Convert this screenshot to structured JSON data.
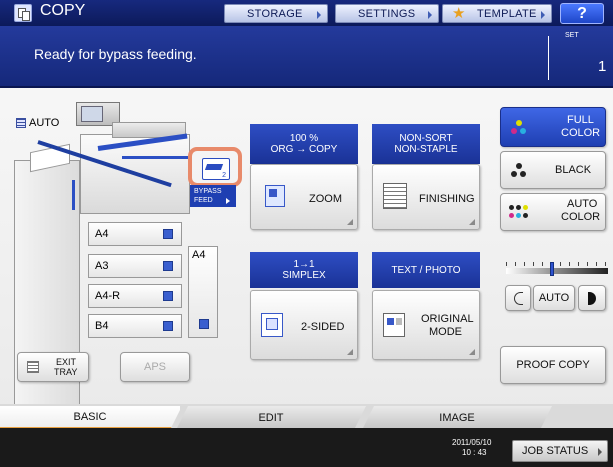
{
  "header": {
    "title": "COPY",
    "buttons": {
      "storage": "STORAGE",
      "settings": "SETTINGS",
      "template": "TEMPLATE",
      "help": "?"
    }
  },
  "message": {
    "text": "Ready for bypass feeding.",
    "set_label": "SET",
    "set_value": "1"
  },
  "machine": {
    "auto_label": "AUTO",
    "bypass_label": "BYPASS\nFEED",
    "bypass_number": "2",
    "trays": [
      "A4",
      "A3",
      "A4-R",
      "B4"
    ],
    "lcf_tray": "A4"
  },
  "functions": {
    "zoom": {
      "header_line1": "100 %",
      "header_line2": "ORG  →  COPY",
      "label": "ZOOM"
    },
    "finishing": {
      "header_line1": "NON-SORT",
      "header_line2": "NON-STAPLE",
      "label": "FINISHING"
    },
    "duplex": {
      "header_line1": "1→1",
      "header_line2": "SIMPLEX",
      "label": "2-SIDED"
    },
    "original": {
      "header_line1": "TEXT / PHOTO",
      "label_line1": "ORIGINAL",
      "label_line2": "MODE"
    }
  },
  "color_modes": {
    "full_line1": "FULL",
    "full_line2": "COLOR",
    "black": "BLACK",
    "auto_line1": "AUTO",
    "auto_line2": "COLOR"
  },
  "density": {
    "auto_label": "AUTO",
    "level": 0.45
  },
  "buttons": {
    "exit_tray_line1": "EXIT",
    "exit_tray_line2": "TRAY",
    "aps": "APS",
    "proof_copy": "PROOF COPY"
  },
  "tabs": [
    "BASIC",
    "EDIT",
    "IMAGE"
  ],
  "footer": {
    "date": "2011/05/10",
    "time": "10 : 43",
    "job_status": "JOB STATUS"
  },
  "colors": {
    "header_bg": "#12247a",
    "message_bg": "#1e34a0",
    "active_tab_underline": "#e8a040",
    "bypass_highlight": "#e88a6a"
  }
}
